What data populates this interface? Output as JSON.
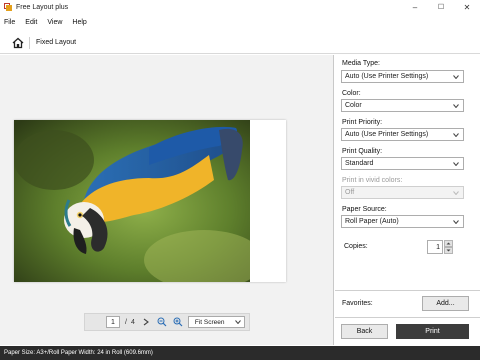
{
  "window": {
    "title": "Free Layout plus",
    "minimize": "–",
    "maximize": "☐",
    "close": "✕"
  },
  "menu": [
    "File",
    "Edit",
    "View",
    "Help"
  ],
  "nav": {
    "label": "Fixed Layout"
  },
  "pager": {
    "current_page": "1",
    "separator": "/",
    "total_pages": "4",
    "zoom": "Fit Screen"
  },
  "settings": {
    "media_type": {
      "label": "Media Type:",
      "value": "Auto (Use Printer Settings)"
    },
    "color": {
      "label": "Color:",
      "value": "Color"
    },
    "print_priority": {
      "label": "Print Priority:",
      "value": "Auto (Use Printer Settings)"
    },
    "print_quality": {
      "label": "Print Quality:",
      "value": "Standard"
    },
    "vivid": {
      "label": "Print in vivid colors:",
      "value": "Off"
    },
    "paper_source": {
      "label": "Paper Source:",
      "value": "Roll Paper (Auto)"
    },
    "copies": {
      "label": "Copies:",
      "value": "1"
    }
  },
  "favorites": {
    "label": "Favorites:",
    "button": "Add..."
  },
  "actions": {
    "back": "Back",
    "print": "Print"
  },
  "status": {
    "text": "Paper Size: A3+/Roll Paper Width: 24 in Roll (609.6mm)"
  },
  "colors": {
    "print_button": "#3c3c3c",
    "status_bar": "#2b2b2b",
    "preview_bg": "#f2f2f2"
  },
  "icons": [
    "app-icon",
    "home-icon",
    "prev-page-icon",
    "next-page-icon",
    "zoom-out-icon",
    "zoom-in-icon",
    "chevron-down-icon"
  ]
}
